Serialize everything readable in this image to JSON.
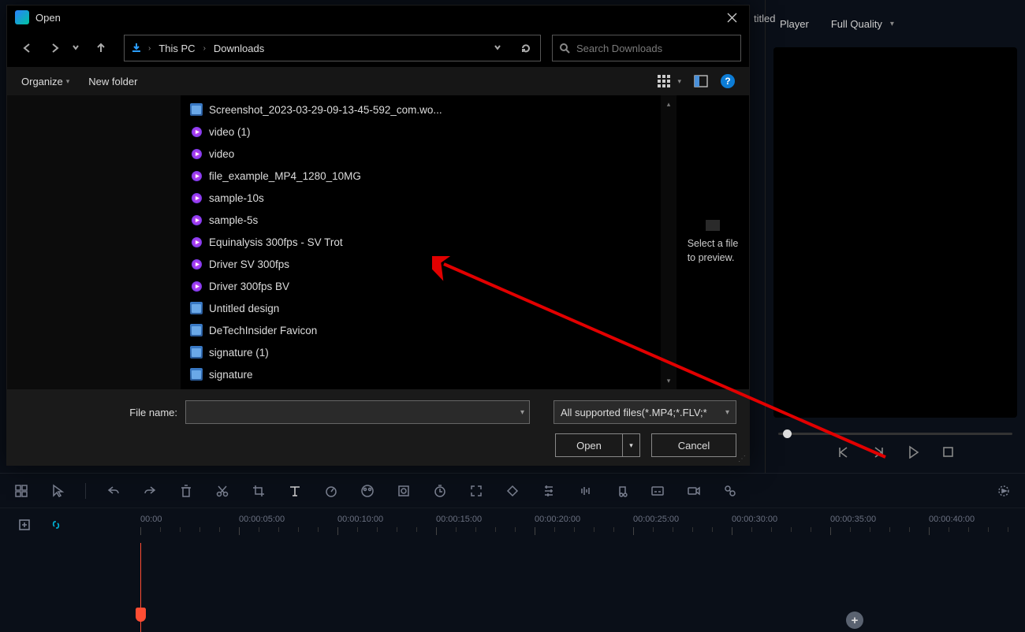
{
  "titled_peek": "titled",
  "dialog": {
    "title": "Open",
    "breadcrumb": {
      "root": "This PC",
      "folder": "Downloads"
    },
    "search_placeholder": "Search Downloads",
    "organize": "Organize",
    "new_folder": "New folder",
    "preview_hint_l1": "Select a file",
    "preview_hint_l2": "to preview.",
    "filename_label": "File name:",
    "filetype": "All supported files(*.MP4;*.FLV;*",
    "open_btn": "Open",
    "cancel_btn": "Cancel",
    "files": [
      {
        "type": "img",
        "name": "Screenshot_2023-03-29-09-13-45-592_com.wo..."
      },
      {
        "type": "vid",
        "name": "video (1)"
      },
      {
        "type": "vid",
        "name": "video"
      },
      {
        "type": "vid",
        "name": "file_example_MP4_1280_10MG"
      },
      {
        "type": "vid",
        "name": "sample-10s"
      },
      {
        "type": "vid",
        "name": "sample-5s"
      },
      {
        "type": "vid",
        "name": "Equinalysis 300fps - SV Trot"
      },
      {
        "type": "vid",
        "name": "Driver SV 300fps"
      },
      {
        "type": "vid",
        "name": "Driver 300fps BV"
      },
      {
        "type": "img",
        "name": "Untitled design"
      },
      {
        "type": "img",
        "name": "DeTechInsider Favicon"
      },
      {
        "type": "img",
        "name": "signature (1)"
      },
      {
        "type": "img",
        "name": "signature"
      }
    ]
  },
  "preview": {
    "player_label": "Player",
    "quality": "Full Quality"
  },
  "timeline": {
    "ticks": [
      "00:00",
      "00:00:05:00",
      "00:00:10:00",
      "00:00:15:00",
      "00:00:20:00",
      "00:00:25:00",
      "00:00:30:00",
      "00:00:35:00",
      "00:00:40:00",
      "00:00"
    ]
  }
}
